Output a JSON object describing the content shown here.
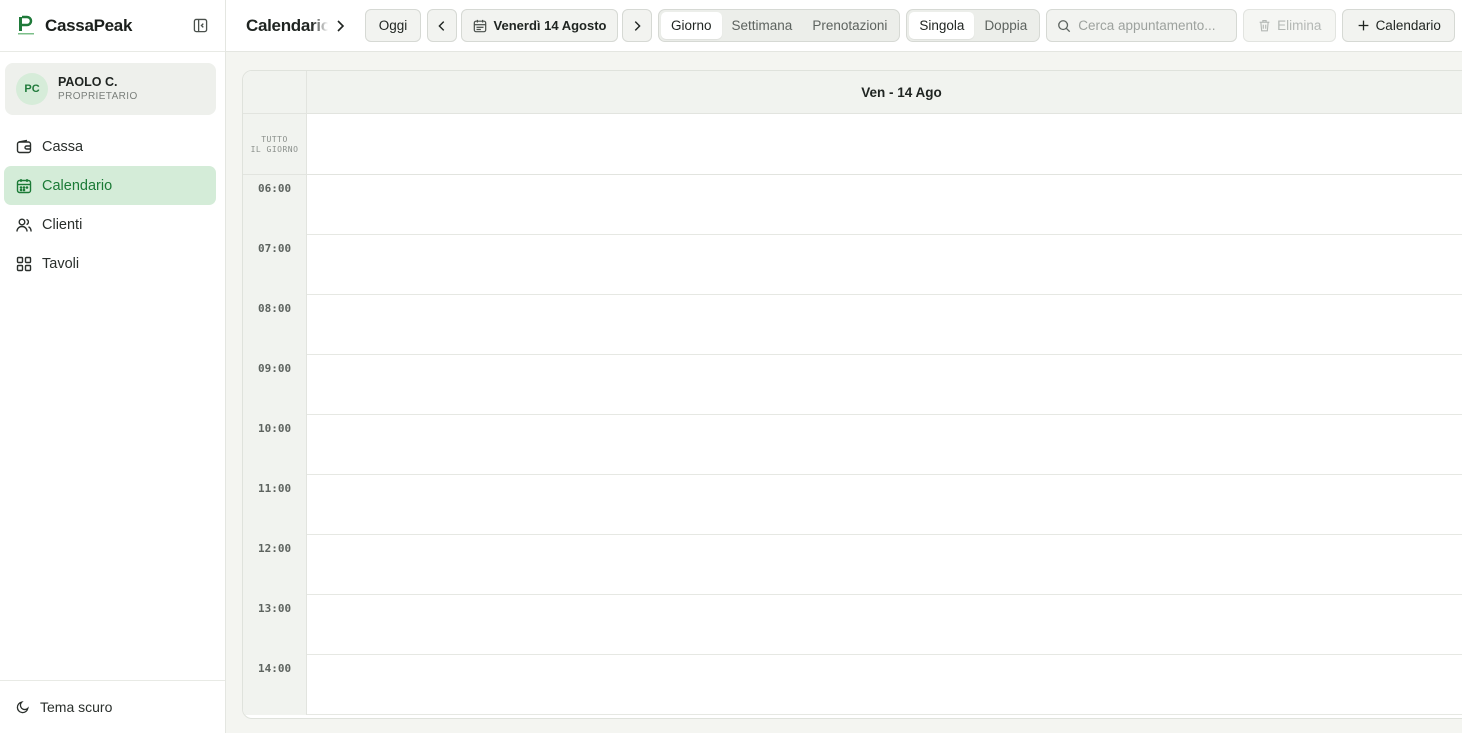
{
  "brand": {
    "name": "CassaPeak"
  },
  "user": {
    "initials": "PC",
    "name": "PAOLO C.",
    "role": "PROPRIETARIO"
  },
  "nav": [
    {
      "label": "Cassa",
      "icon": "wallet-icon",
      "active": false
    },
    {
      "label": "Calendario",
      "icon": "calendar-icon",
      "active": true
    },
    {
      "label": "Clienti",
      "icon": "users-icon",
      "active": false
    },
    {
      "label": "Tavoli",
      "icon": "grid-icon",
      "active": false
    }
  ],
  "footer": {
    "theme_label": "Tema scuro"
  },
  "toolbar": {
    "title": "Calendario",
    "today_label": "Oggi",
    "date_label": "Venerdì 14 Agosto",
    "views": [
      {
        "label": "Giorno",
        "active": true
      },
      {
        "label": "Settimana",
        "active": false
      },
      {
        "label": "Prenotazioni",
        "active": false
      }
    ],
    "layouts": [
      {
        "label": "Singola",
        "active": true
      },
      {
        "label": "Doppia",
        "active": false
      }
    ],
    "search_placeholder": "Cerca appuntamento...",
    "delete_label": "Elimina",
    "add_label": "Calendario"
  },
  "calendar": {
    "day_header": "Ven - 14 Ago",
    "allday_line1": "TUTTO",
    "allday_line2": "IL GIORNO",
    "hours": [
      "06:00",
      "07:00",
      "08:00",
      "09:00",
      "10:00",
      "11:00",
      "12:00",
      "13:00",
      "14:00"
    ]
  },
  "colors": {
    "accent": "#1b7a36",
    "accent_bg": "#d4ecd8",
    "background": "#f4f5f1"
  }
}
